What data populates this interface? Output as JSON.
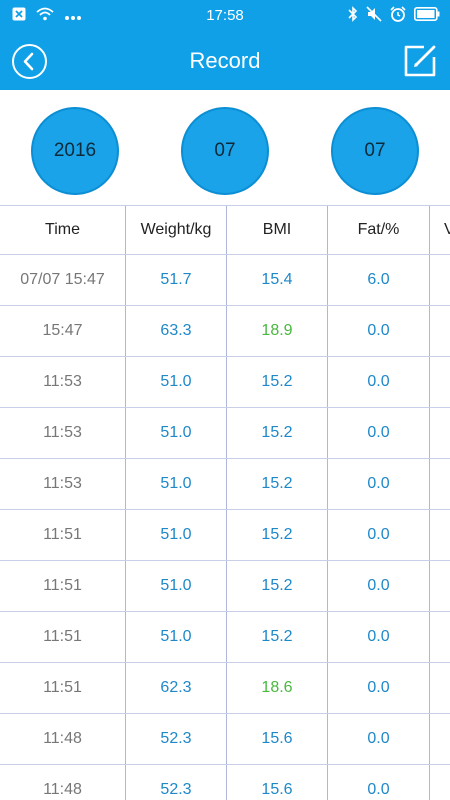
{
  "status_bar": {
    "time": "17:58",
    "left_icons": [
      "close-box-icon",
      "wifi-icon",
      "more-dots-icon"
    ],
    "right_icons": [
      "bluetooth-icon",
      "mute-icon",
      "alarm-icon",
      "battery-icon"
    ]
  },
  "header": {
    "title": "Record",
    "back_icon": "back-arrow-icon",
    "edit_icon": "edit-icon"
  },
  "date_selector": {
    "year": "2016",
    "month": "07",
    "day": "07"
  },
  "table": {
    "columns": [
      "Time",
      "Weight/kg",
      "BMI",
      "Fat/%",
      "V"
    ],
    "rows": [
      {
        "time": "07/07 15:47",
        "weight": "51.7",
        "bmi": "15.4",
        "bmi_status": "normal",
        "fat": "6.0"
      },
      {
        "time": "15:47",
        "weight": "63.3",
        "bmi": "18.9",
        "bmi_status": "good",
        "fat": "0.0"
      },
      {
        "time": "11:53",
        "weight": "51.0",
        "bmi": "15.2",
        "bmi_status": "normal",
        "fat": "0.0"
      },
      {
        "time": "11:53",
        "weight": "51.0",
        "bmi": "15.2",
        "bmi_status": "normal",
        "fat": "0.0"
      },
      {
        "time": "11:53",
        "weight": "51.0",
        "bmi": "15.2",
        "bmi_status": "normal",
        "fat": "0.0"
      },
      {
        "time": "11:51",
        "weight": "51.0",
        "bmi": "15.2",
        "bmi_status": "normal",
        "fat": "0.0"
      },
      {
        "time": "11:51",
        "weight": "51.0",
        "bmi": "15.2",
        "bmi_status": "normal",
        "fat": "0.0"
      },
      {
        "time": "11:51",
        "weight": "51.0",
        "bmi": "15.2",
        "bmi_status": "normal",
        "fat": "0.0"
      },
      {
        "time": "11:51",
        "weight": "62.3",
        "bmi": "18.6",
        "bmi_status": "good",
        "fat": "0.0"
      },
      {
        "time": "11:48",
        "weight": "52.3",
        "bmi": "15.6",
        "bmi_status": "normal",
        "fat": "0.0"
      },
      {
        "time": "11:48",
        "weight": "52.3",
        "bmi": "15.6",
        "bmi_status": "normal",
        "fat": "0.0"
      }
    ]
  },
  "colors": {
    "primary": "#0fa0e8",
    "value_blue": "#1e88c9",
    "value_green": "#49b83e",
    "time_gray": "#777777",
    "grid": "#aeb6d9"
  }
}
